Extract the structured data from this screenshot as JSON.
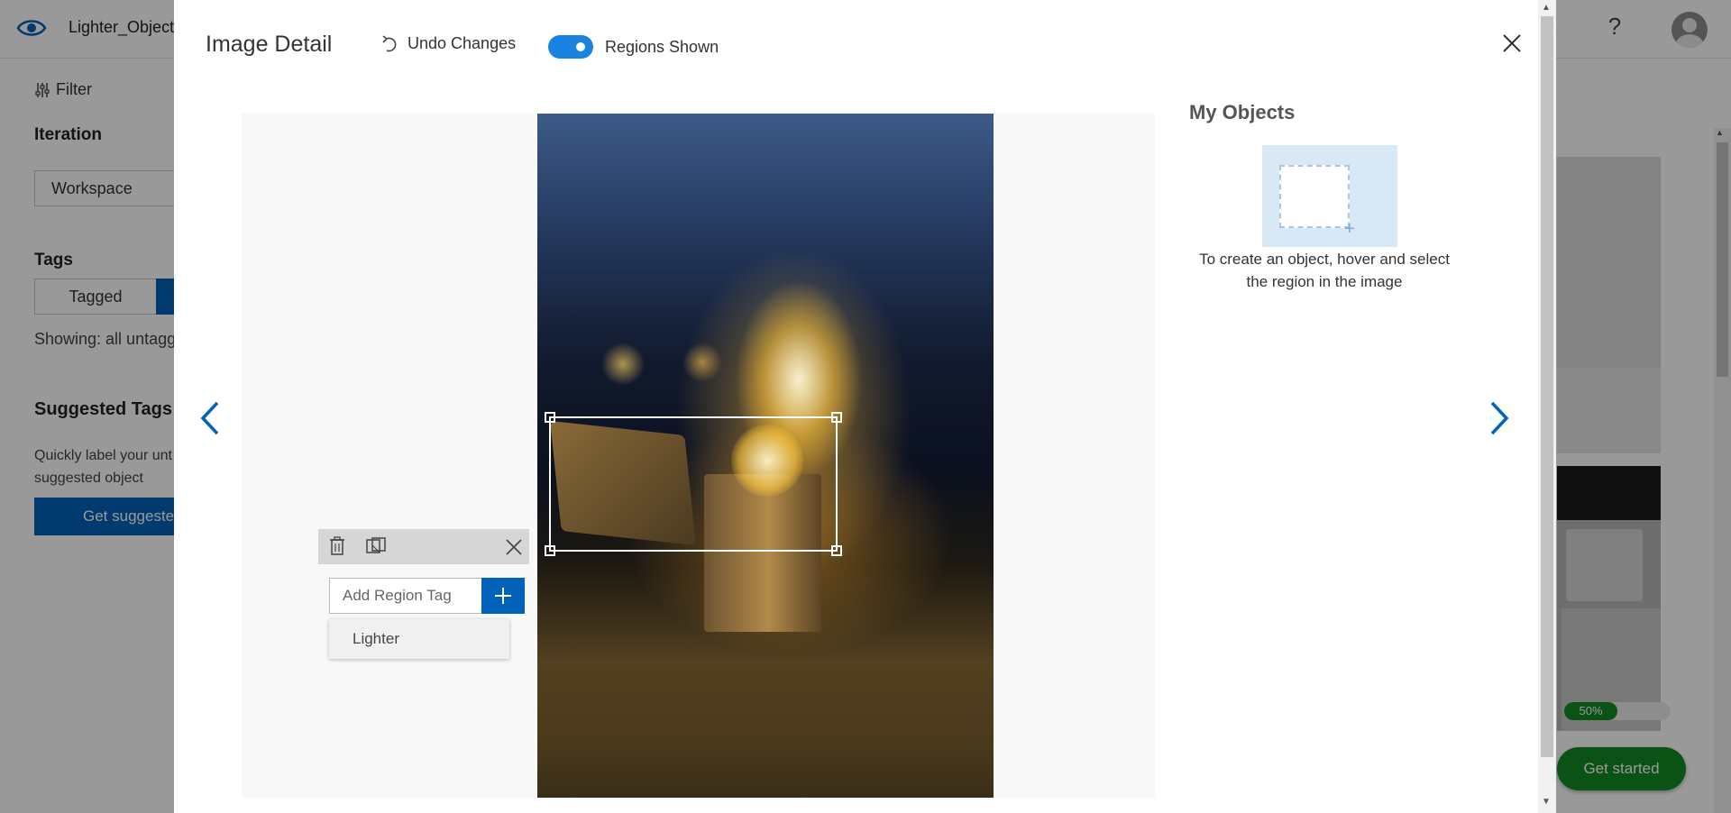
{
  "app": {
    "project_name": "Lighter_Object",
    "header_fragment": "s",
    "help_label": "?",
    "filter_label": "Filter",
    "iteration_heading": "Iteration",
    "iteration_value": "Workspace",
    "tags_heading": "Tags",
    "tagged_label": "Tagged",
    "showing_text": "Showing: all untagg",
    "suggested_heading": "Suggested Tags",
    "suggested_desc": "Quickly label your unt with suggested object",
    "get_suggested_label": "Get suggested",
    "progress": {
      "percent": 50,
      "label": "50%"
    },
    "get_started_label": "Get started"
  },
  "modal": {
    "title": "Image Detail",
    "undo_label": "Undo Changes",
    "regions_toggle": {
      "label": "Regions Shown",
      "on": true
    },
    "region_tag_input": {
      "placeholder": "Add Region Tag",
      "value": ""
    },
    "tag_suggestions": [
      "Lighter"
    ],
    "my_objects": {
      "title": "My Objects",
      "help_text": "To create an object, hover and select the region in the image"
    }
  },
  "colors": {
    "accent": "#0062b8",
    "toggle": "#1a82e0",
    "success": "#128a23"
  },
  "icons": [
    "eye-logo-icon",
    "filter-icon",
    "undo-icon",
    "close-icon",
    "trash-icon",
    "crop-icon",
    "plus-icon",
    "chevron-left-icon",
    "chevron-right-icon",
    "avatar-icon",
    "help-icon"
  ]
}
